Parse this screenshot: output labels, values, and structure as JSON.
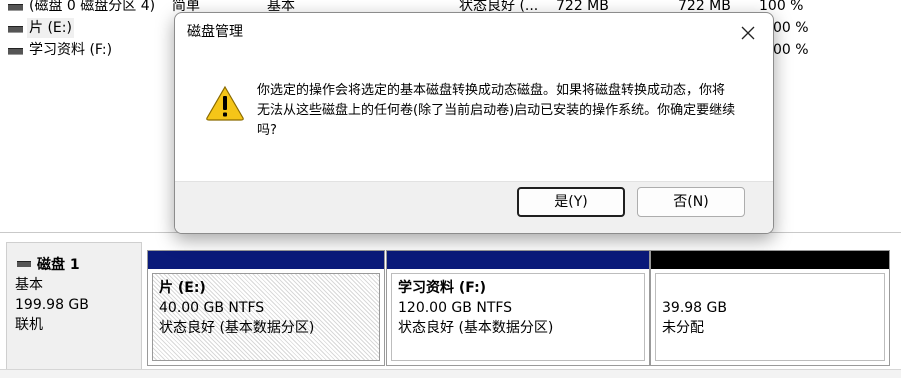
{
  "volumes": [
    {
      "name": "(磁盘 0 磁盘分区 4)",
      "layout": "简单",
      "type": "基本",
      "status": "状态良好 (...",
      "capacity": "722 MB",
      "free": "722 MB",
      "pct": "100 %"
    },
    {
      "name": "片 (E:)",
      "pct": "00 %"
    },
    {
      "name": "学习资料 (F:)",
      "pct": "00 %"
    }
  ],
  "disk": {
    "name": "磁盘 1",
    "type": "基本",
    "size": "199.98 GB",
    "state": "联机"
  },
  "partitions": [
    {
      "title": "片  (E:)",
      "size": "40.00 GB NTFS",
      "status": "状态良好 (基本数据分区)",
      "bar_color": "#0a1a7a"
    },
    {
      "title": "学习资料  (F:)",
      "size": "120.00 GB NTFS",
      "status": "状态良好 (基本数据分区)",
      "bar_color": "#0a1a7a"
    },
    {
      "title": "",
      "size": "39.98 GB",
      "status": "未分配",
      "bar_color": "#000000"
    }
  ],
  "dialog": {
    "title": "磁盘管理",
    "message": "你选定的操作会将选定的基本磁盘转换成动态磁盘。如果将磁盘转换成动态，你将无法从这些磁盘上的任何卷(除了当前启动卷)启动已安装的操作系统。你确定要继续吗?",
    "yes_label": "是(Y)",
    "no_label": "否(N)",
    "close_glyph": "✕"
  },
  "icons": {
    "warning": "warning-icon",
    "close": "close-icon",
    "volume": "volume-icon",
    "disk": "disk-icon"
  }
}
